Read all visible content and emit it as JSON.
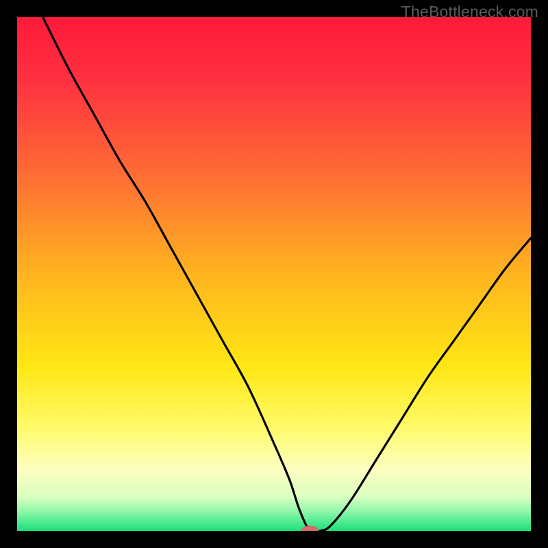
{
  "watermark": "TheBottleneck.com",
  "chart_data": {
    "type": "line",
    "title": "",
    "xlabel": "",
    "ylabel": "",
    "xlim": [
      0,
      100
    ],
    "ylim": [
      0,
      100
    ],
    "grid": false,
    "legend": false,
    "gradient_stops": [
      {
        "offset": 0.0,
        "color": "#ff1a3a"
      },
      {
        "offset": 0.12,
        "color": "#ff3040"
      },
      {
        "offset": 0.3,
        "color": "#ff6a35"
      },
      {
        "offset": 0.5,
        "color": "#ffb41f"
      },
      {
        "offset": 0.68,
        "color": "#ffe714"
      },
      {
        "offset": 0.8,
        "color": "#fffb6a"
      },
      {
        "offset": 0.88,
        "color": "#fdffc0"
      },
      {
        "offset": 0.935,
        "color": "#d8ffbf"
      },
      {
        "offset": 0.965,
        "color": "#86f5a7"
      },
      {
        "offset": 1.0,
        "color": "#1be07a"
      }
    ],
    "marker": {
      "x": 57,
      "y": 0,
      "color": "#d46a6a",
      "rx": 1.7,
      "ry": 1.0
    },
    "series": [
      {
        "name": "curve",
        "x": [
          5,
          10,
          15,
          20,
          25,
          30,
          35,
          40,
          45,
          50,
          53,
          55,
          57,
          59,
          61,
          65,
          70,
          75,
          80,
          85,
          90,
          95,
          100
        ],
        "values": [
          100,
          90,
          81,
          72,
          64,
          55,
          46,
          37,
          28,
          17,
          10,
          4,
          0,
          0,
          1,
          6,
          14,
          22,
          30,
          37,
          44,
          51,
          57
        ]
      }
    ]
  }
}
